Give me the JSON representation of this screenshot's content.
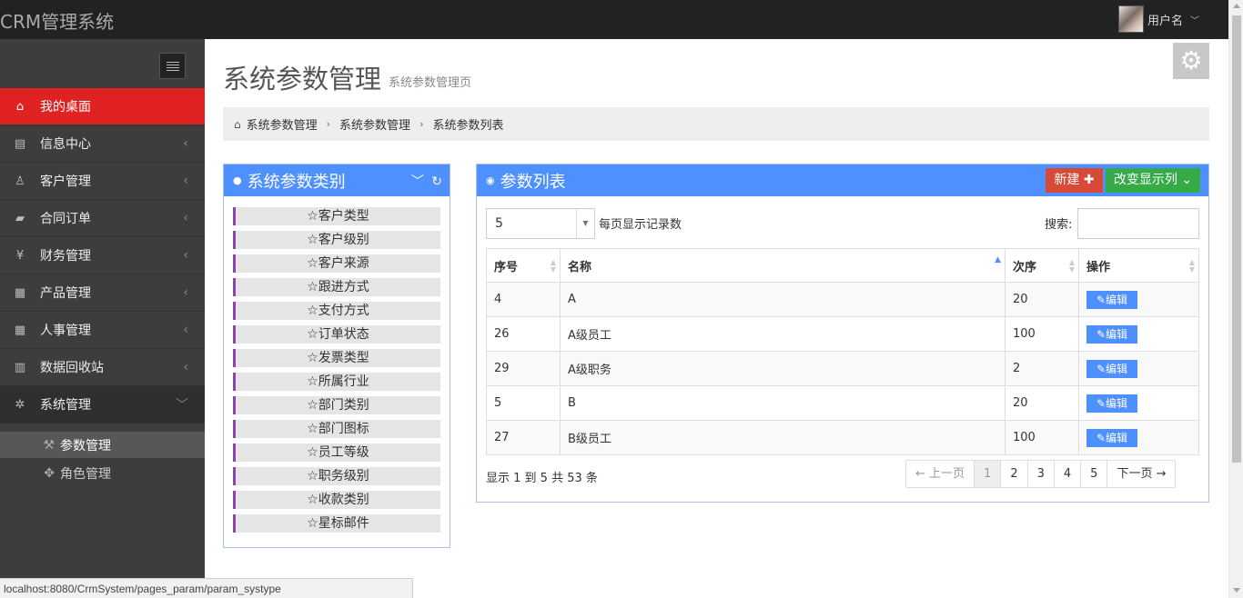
{
  "header": {
    "brand": "CRM管理系统",
    "username": "用户名"
  },
  "sidebar": {
    "items": [
      {
        "label": "我的桌面",
        "icon": "home-icon"
      },
      {
        "label": "信息中心",
        "icon": "message-icon"
      },
      {
        "label": "客户管理",
        "icon": "customer-icon"
      },
      {
        "label": "合同订单",
        "icon": "book-icon"
      },
      {
        "label": "财务管理",
        "icon": "yen-icon"
      },
      {
        "label": "产品管理",
        "icon": "table-icon"
      },
      {
        "label": "人事管理",
        "icon": "table-icon"
      },
      {
        "label": "数据回收站",
        "icon": "trash-icon"
      },
      {
        "label": "系统管理",
        "icon": "gear-icon"
      }
    ],
    "subitems": [
      {
        "label": "参数管理",
        "icon": "wrench-icon"
      },
      {
        "label": "角色管理",
        "icon": "cog-icon"
      }
    ]
  },
  "page": {
    "title": "系统参数管理",
    "subtitle": "系统参数管理页",
    "breadcrumb": [
      "系统参数管理",
      "系统参数管理",
      "系统参数列表"
    ]
  },
  "category_panel": {
    "title": "系统参数类别",
    "items": [
      "☆客户类型",
      "☆客户级别",
      "☆客户来源",
      "☆跟进方式",
      "☆支付方式",
      "☆订单状态",
      "☆发票类型",
      "☆所属行业",
      "☆部门类别",
      "☆部门图标",
      "☆员工等级",
      "☆职务级别",
      "☆收款类别",
      "☆星标邮件"
    ]
  },
  "param_panel": {
    "title": "参数列表",
    "new_button": "新建",
    "columns_button": "改变显示列",
    "page_length": "5",
    "page_length_label": "每页显示记录数",
    "search_label": "搜索:",
    "table": {
      "headers": [
        "序号",
        "名称",
        "次序",
        "操作"
      ],
      "rows": [
        {
          "id": "4",
          "name": "A",
          "order": "20",
          "action": "编辑"
        },
        {
          "id": "26",
          "name": "A级员工",
          "order": "100",
          "action": "编辑"
        },
        {
          "id": "29",
          "name": "A级职务",
          "order": "2",
          "action": "编辑"
        },
        {
          "id": "5",
          "name": "B",
          "order": "20",
          "action": "编辑"
        },
        {
          "id": "27",
          "name": "B级员工",
          "order": "100",
          "action": "编辑"
        }
      ]
    },
    "info": "显示 1 到 5 共 53 条",
    "pagination": {
      "prev": "← 上一页",
      "pages": [
        "1",
        "2",
        "3",
        "4",
        "5"
      ],
      "next": "下一页 →",
      "current": "1"
    }
  },
  "statusbar": {
    "url": "localhost:8080/CrmSystem/pages_param/param_systype"
  },
  "colors": {
    "accent": "#4d90fe",
    "active_menu": "#e02222",
    "new_button": "#d84a38",
    "columns_button": "#35aa47",
    "category_border": "#8e44ad"
  }
}
